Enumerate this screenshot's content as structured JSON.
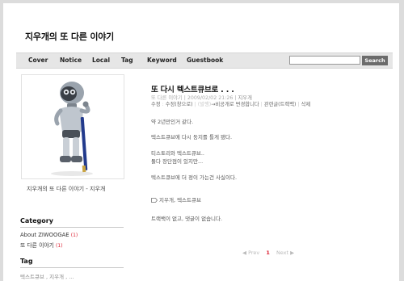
{
  "blog": {
    "title": "지우개의 또 다른 이야기"
  },
  "nav": {
    "items": [
      "Cover",
      "Notice",
      "Local",
      "Tag",
      "Keyword",
      "Guestbook"
    ],
    "search_value": "",
    "search_button": "Search"
  },
  "sidebar": {
    "profile_caption": "지우개의 또 다른 이야기 - 지우개",
    "category_heading": "Category",
    "categories": [
      {
        "label": "About ZIWOOGAE",
        "count": "(1)"
      },
      {
        "label": "또 다른 이야기",
        "count": "(1)"
      }
    ],
    "tag_heading": "Tag",
    "tags_line": "텍스트큐브 , 지우개 , ..."
  },
  "post": {
    "title": "또 다시 텍스트큐브로 . . .",
    "meta_category": "또 다른 이야기",
    "meta_date": "2009/02/02 21:26",
    "meta_author": "지우개",
    "actions": {
      "edit": "수정",
      "edit_window": "수정(창으로)",
      "visibility": "(발행)",
      "make_private": "→비공개로 변경합니다",
      "related": "관련글(트랙백)",
      "delete": "삭제"
    },
    "body": [
      "약 2년만인거 같다.",
      "텍스트큐브에 다시 둥지를 틀게 됐다.",
      "티스토리와 텍스트큐브..",
      "둘다 장단점이 있지만...",
      "텍스트큐브에 더 정이 가는건 사실이다."
    ],
    "tags": "지우개, 텍스트큐브",
    "comment_info": "트랙백이 없고, 댓글이 없습니다."
  },
  "pager": {
    "prev": "◀ Prev",
    "current": "1",
    "next": "Next ▶"
  }
}
